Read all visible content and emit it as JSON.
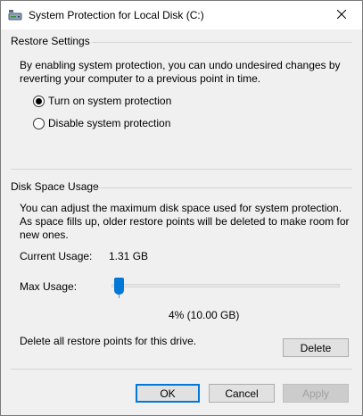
{
  "window": {
    "title": "System Protection for Local Disk (C:)",
    "close_symbol": "✕"
  },
  "restore_settings": {
    "group_label": "Restore Settings",
    "description": "By enabling system protection, you can undo undesired changes by reverting your computer to a previous point in time.",
    "options": [
      {
        "label": "Turn on system protection",
        "checked": true
      },
      {
        "label": "Disable system protection",
        "checked": false
      }
    ]
  },
  "disk_space": {
    "group_label": "Disk Space Usage",
    "description": "You can adjust the maximum disk space used for system protection. As space fills up, older restore points will be deleted to make room for new ones.",
    "current_usage_label": "Current Usage:",
    "current_usage_value": "1.31 GB",
    "max_usage_label": "Max Usage:",
    "max_usage_display": "4% (10.00 GB)",
    "max_usage_percent": 4,
    "delete_text": "Delete all restore points for this drive.",
    "delete_button": "Delete"
  },
  "footer": {
    "ok": "OK",
    "cancel": "Cancel",
    "apply": "Apply"
  },
  "colors": {
    "accent": "#0078d7",
    "window_bg": "#f0f0f0",
    "titlebar_bg": "#ffffff",
    "disabled_text": "#a0a0a0"
  },
  "icons": {
    "title": "drive-protection-icon",
    "close": "close-icon"
  }
}
